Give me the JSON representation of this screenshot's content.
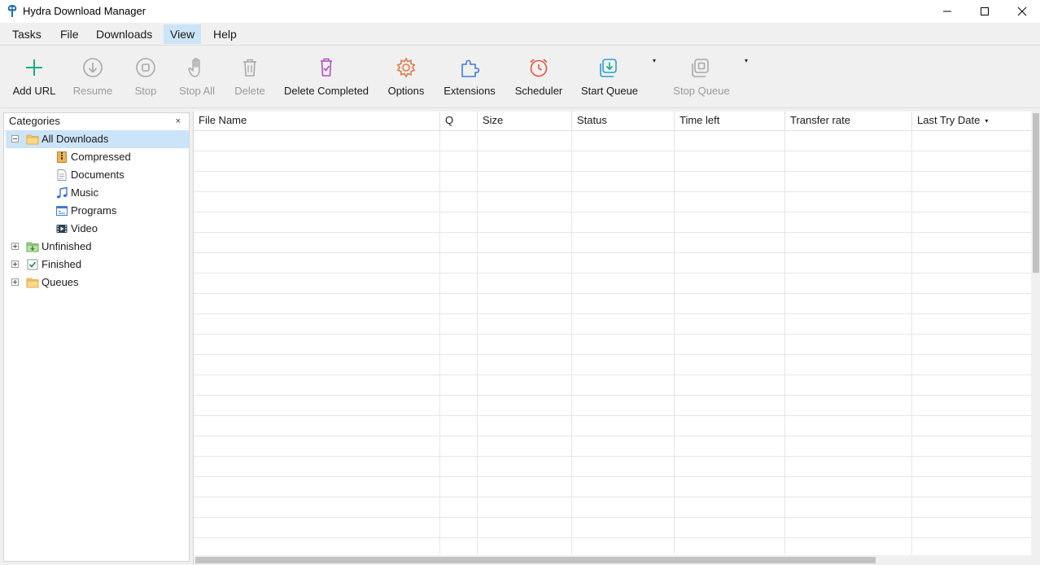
{
  "window": {
    "title": "Hydra Download Manager",
    "minimize_icon": "minimize-icon",
    "maximize_icon": "maximize-icon",
    "close_icon": "close-icon"
  },
  "menu": {
    "items": [
      "Tasks",
      "File",
      "Downloads",
      "View",
      "Help"
    ],
    "active": "View"
  },
  "toolbar": {
    "buttons": [
      {
        "label": "Add URL",
        "icon": "plus-icon",
        "enabled": true,
        "color": "#1aab8a"
      },
      {
        "label": "Resume",
        "icon": "resume-download-icon",
        "enabled": false,
        "color": "#a8a8a8"
      },
      {
        "label": "Stop",
        "icon": "stop-icon",
        "enabled": false,
        "color": "#a8a8a8"
      },
      {
        "label": "Stop All",
        "icon": "hand-icon",
        "enabled": false,
        "color": "#a8a8a8"
      },
      {
        "label": "Delete",
        "icon": "trash-icon",
        "enabled": false,
        "color": "#a8a8a8"
      },
      {
        "label": "Delete Completed",
        "icon": "trash-check-icon",
        "enabled": true,
        "color": "#b04fc4"
      },
      {
        "label": "Options",
        "icon": "gear-icon",
        "enabled": true,
        "color": "#e07a4a"
      },
      {
        "label": "Extensions",
        "icon": "puzzle-icon",
        "enabled": true,
        "color": "#3d7bd6"
      },
      {
        "label": "Scheduler",
        "icon": "alarm-clock-icon",
        "enabled": true,
        "color": "#e5533d"
      },
      {
        "label": "Start Queue",
        "icon": "queue-download-icon",
        "enabled": true,
        "color": "#2a9fd6"
      },
      {
        "label": "Stop Queue",
        "icon": "queue-stop-icon",
        "enabled": false,
        "color": "#a8a8a8"
      }
    ],
    "start_queue_caret": "▾",
    "stop_queue_caret": "▾"
  },
  "categories": {
    "header": "Categories",
    "close": "×",
    "tree": [
      {
        "label": "All Downloads",
        "icon": "folder-icon",
        "selected": true
      },
      {
        "label": "Compressed",
        "icon": "archive-icon"
      },
      {
        "label": "Documents",
        "icon": "document-icon"
      },
      {
        "label": "Music",
        "icon": "music-note-icon"
      },
      {
        "label": "Programs",
        "icon": "program-window-icon"
      },
      {
        "label": "Video",
        "icon": "film-icon"
      },
      {
        "label": "Unfinished",
        "icon": "unfinished-folder-icon"
      },
      {
        "label": "Finished",
        "icon": "finished-check-icon"
      },
      {
        "label": "Queues",
        "icon": "queues-folder-icon"
      }
    ]
  },
  "table": {
    "columns": [
      "File Name",
      "Q",
      "Size",
      "Status",
      "Time left",
      "Transfer rate",
      "Last Try Date"
    ],
    "sort_indicator": "▾",
    "rows": []
  },
  "colors": {
    "accent_selection": "#cce4f7",
    "window_bg": "#f0f0f0"
  }
}
